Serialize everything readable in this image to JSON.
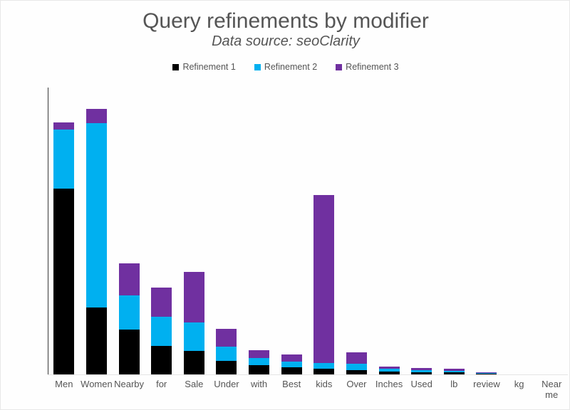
{
  "chart": {
    "title": "Query refinements by modifier",
    "subtitle": "Data source: seoClarity"
  },
  "legend": {
    "position": "top-center",
    "items": [
      {
        "label": "Refinement 1",
        "color": "#000000"
      },
      {
        "label": "Refinement 2",
        "color": "#00B0F0"
      },
      {
        "label": "Refinement 3",
        "color": "#7030A0"
      }
    ]
  },
  "chart_data": {
    "type": "bar",
    "stacked": true,
    "title": "Query refinements by modifier",
    "subtitle": "Data source: seoClarity",
    "xlabel": "",
    "ylabel": "",
    "ylim": [
      0,
      16000
    ],
    "ytick_labels": [
      "0",
      "2,000",
      "4,000",
      "6,000",
      "8,000",
      "10,000",
      "12,000",
      "14,000",
      "16,000"
    ],
    "ytick_values": [
      0,
      2000,
      4000,
      6000,
      8000,
      10000,
      12000,
      14000,
      16000
    ],
    "grid": false,
    "legend_position": "top-center",
    "categories": [
      "Men",
      "Women",
      "Nearby",
      "for",
      "Sale",
      "Under",
      "with",
      "Best",
      "kids",
      "Over",
      "Inches",
      "Used",
      "lb",
      "review",
      "kg",
      "Near me"
    ],
    "series": [
      {
        "name": "Refinement 1",
        "color": "#000000",
        "values": [
          10350,
          3750,
          2500,
          1600,
          1300,
          750,
          500,
          400,
          300,
          250,
          150,
          120,
          100,
          40,
          0,
          0
        ]
      },
      {
        "name": "Refinement 2",
        "color": "#00B0F0",
        "values": [
          3300,
          10250,
          1900,
          1600,
          1600,
          800,
          400,
          300,
          350,
          350,
          150,
          120,
          100,
          50,
          0,
          0
        ]
      },
      {
        "name": "Refinement 3",
        "color": "#7030A0",
        "values": [
          400,
          800,
          1800,
          1650,
          2800,
          1000,
          450,
          400,
          9350,
          650,
          150,
          130,
          100,
          30,
          0,
          0
        ]
      }
    ],
    "totals": [
      14050,
      14800,
      6200,
      4850,
      5700,
      2550,
      1350,
      1100,
      10000,
      1250,
      450,
      370,
      300,
      120,
      0,
      0
    ]
  }
}
